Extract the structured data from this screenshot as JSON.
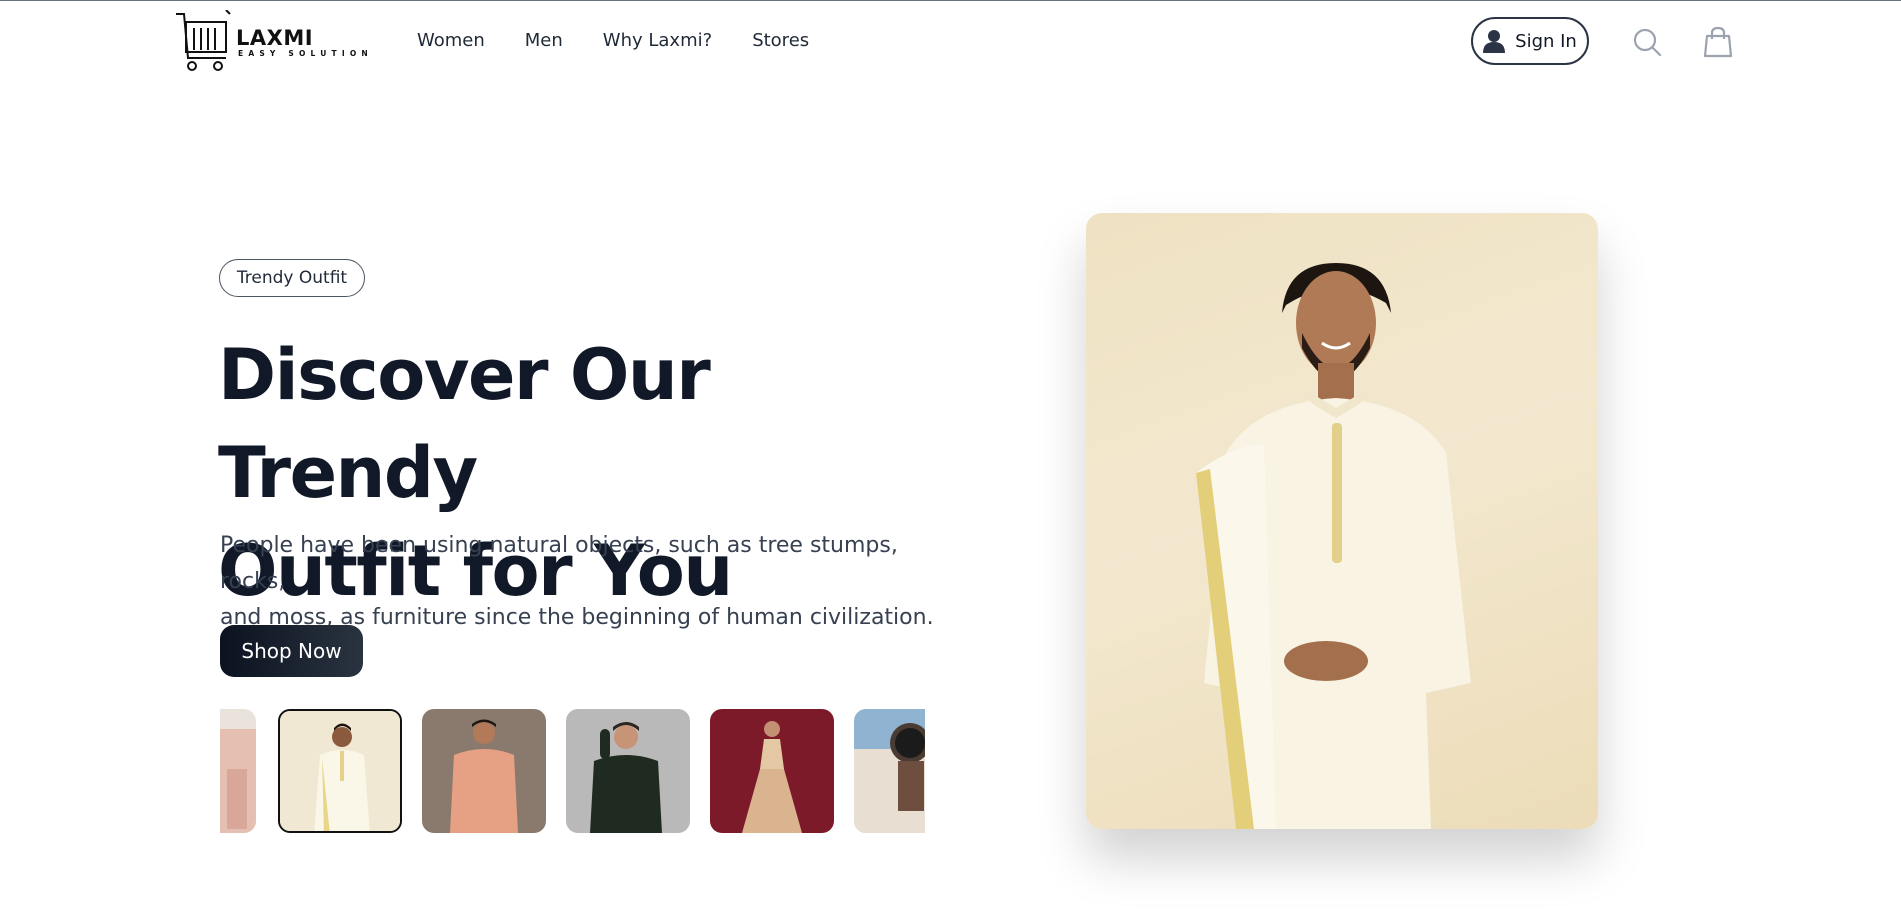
{
  "brand": {
    "name": "LAXMI",
    "tagline": "EASY SOLUTION"
  },
  "nav": {
    "items": [
      {
        "label": "Women"
      },
      {
        "label": "Men"
      },
      {
        "label": "Why Laxmi?"
      },
      {
        "label": "Stores"
      }
    ]
  },
  "header": {
    "signin_label": "Sign In",
    "icons": [
      "user-icon",
      "search-icon",
      "shopping-bag-icon"
    ]
  },
  "hero": {
    "badge": "Trendy Outfit",
    "title_line1": "Discover Our Trendy",
    "title_line2": "Outfit for You",
    "description_line1": "People have been using natural objects, such as tree stumps, rocks,",
    "description_line2": "and moss, as furniture since the beginning of human civilization.",
    "cta_label": "Shop Now"
  },
  "thumbnails": {
    "selected_index": 1,
    "items": [
      {
        "subject": "woman in pink outfit (partially visible)"
      },
      {
        "subject": "man in cream kurta"
      },
      {
        "subject": "man in peach shirt"
      },
      {
        "subject": "man in dark green shirt"
      },
      {
        "subject": "woman in maroon lehenga"
      },
      {
        "subject": "wrist watch (partially visible)"
      }
    ]
  },
  "colors": {
    "text_dark": "#111827",
    "button_dark": "#0b1220",
    "accent_cream": "#f3e8cf"
  }
}
